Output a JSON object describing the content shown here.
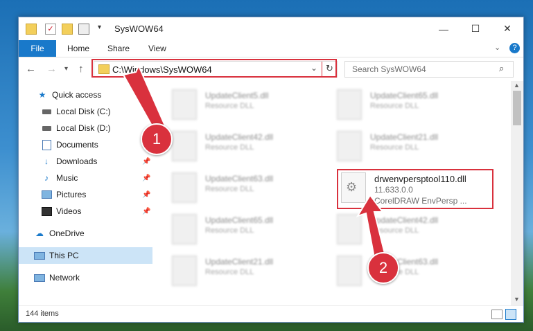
{
  "window": {
    "title": "SysWOW64",
    "controls": {
      "minimize": "—",
      "maximize": "☐",
      "close": "✕"
    }
  },
  "ribbon": {
    "tabs": [
      "File",
      "Home",
      "Share",
      "View"
    ]
  },
  "address": {
    "path": "C:\\Windows\\SysWOW64",
    "search_placeholder": "Search SysWOW64"
  },
  "sidebar": {
    "items": [
      {
        "label": "Quick access",
        "icon": "star-icon",
        "pinned": false
      },
      {
        "label": "Local Disk (C:)",
        "icon": "drive-icon",
        "pinned": false
      },
      {
        "label": "Local Disk (D:)",
        "icon": "drive-icon",
        "pinned": false
      },
      {
        "label": "Documents",
        "icon": "documents-icon",
        "pinned": true
      },
      {
        "label": "Downloads",
        "icon": "downloads-icon",
        "pinned": true
      },
      {
        "label": "Music",
        "icon": "music-icon",
        "pinned": true
      },
      {
        "label": "Pictures",
        "icon": "pictures-icon",
        "pinned": true
      },
      {
        "label": "Videos",
        "icon": "videos-icon",
        "pinned": true
      },
      {
        "label": "OneDrive",
        "icon": "onedrive-icon",
        "pinned": false
      },
      {
        "label": "This PC",
        "icon": "pc-icon",
        "pinned": false,
        "selected": true
      },
      {
        "label": "Network",
        "icon": "network-icon",
        "pinned": false
      }
    ]
  },
  "files": [
    {
      "name": "UpdateClient5.dll",
      "type": "Resource DLL"
    },
    {
      "name": "UpdateClient65.dll",
      "type": "Resource DLL"
    },
    {
      "name": "UpdateClient42.dll",
      "type": "Resource DLL"
    },
    {
      "name": "UpdateClient21.dll",
      "type": "Resource DLL"
    },
    {
      "name": "UpdateClient63.dll",
      "type": "Resource DLL"
    },
    {
      "name": "drwenvpersptool110.dll",
      "version": "11.633.0.0",
      "description": "CorelDRAW EnvPersp ...",
      "highlighted": true
    },
    {
      "name": "UpdateClient65.dll",
      "type": "Resource DLL"
    },
    {
      "name": "UpdateClient42.dll",
      "type": "Resource DLL"
    },
    {
      "name": "UpdateClient21.dll",
      "type": "Resource DLL"
    },
    {
      "name": "UpdateClient63.dll",
      "type": "Resource DLL"
    }
  ],
  "status": {
    "item_count": "144 items"
  },
  "annotations": {
    "step1": "1",
    "step2": "2"
  },
  "colors": {
    "accent": "#1979ca",
    "highlight": "#d9313d",
    "selected": "#cce4f7"
  }
}
